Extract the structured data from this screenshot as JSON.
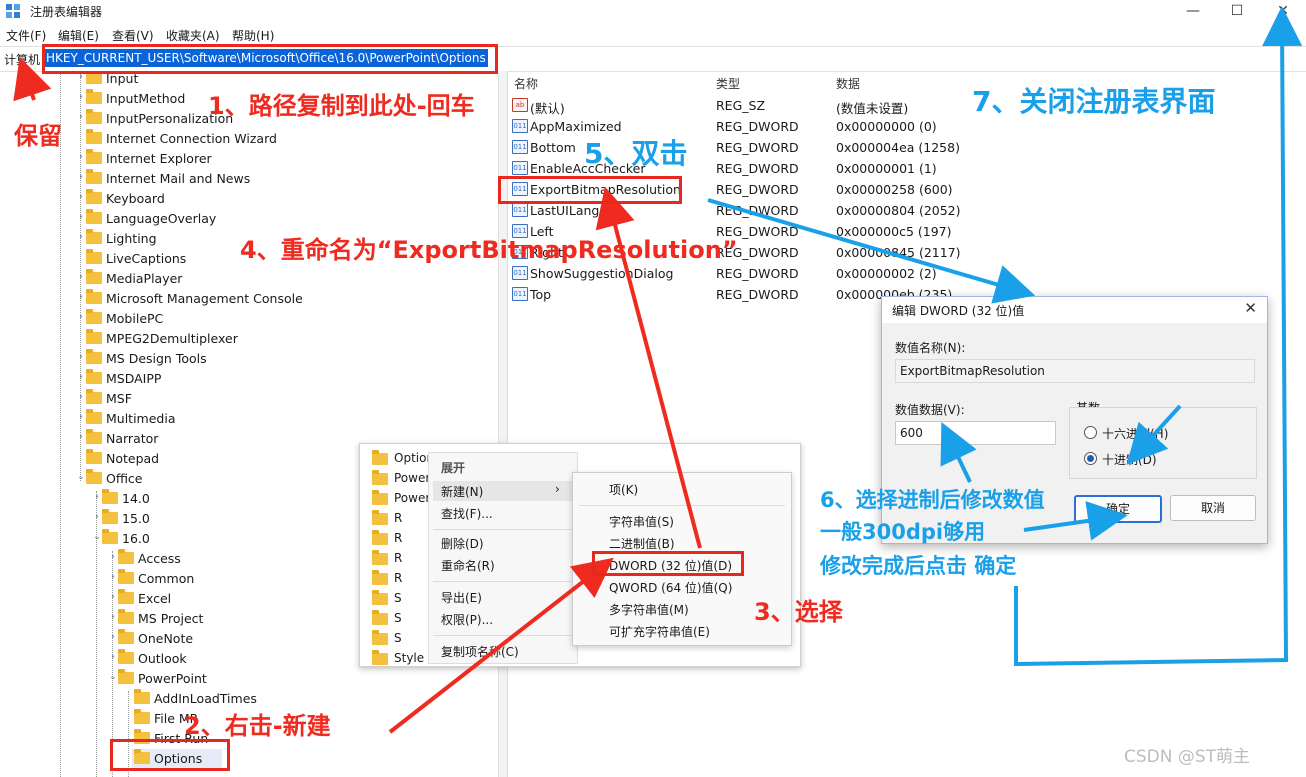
{
  "window": {
    "title": "注册表编辑器",
    "minimize": "—",
    "maximize": "☐",
    "close": "✕"
  },
  "menu": [
    "文件(F)",
    "编辑(E)",
    "查看(V)",
    "收藏夹(A)",
    "帮助(H)"
  ],
  "address": {
    "label": "计算机",
    "path": "HKEY_CURRENT_USER\\Software\\Microsoft\\Office\\16.0\\PowerPoint\\Options"
  },
  "tree": [
    {
      "label": "Input",
      "level": 0,
      "expander": "›"
    },
    {
      "label": "InputMethod",
      "level": 0,
      "expander": "›"
    },
    {
      "label": "InputPersonalization",
      "level": 0,
      "expander": "›"
    },
    {
      "label": "Internet Connection Wizard",
      "level": 0,
      "expander": ""
    },
    {
      "label": "Internet Explorer",
      "level": 0,
      "expander": "›"
    },
    {
      "label": "Internet Mail and News",
      "level": 0,
      "expander": "›"
    },
    {
      "label": "Keyboard",
      "level": 0,
      "expander": "›"
    },
    {
      "label": "LanguageOverlay",
      "level": 0,
      "expander": "›"
    },
    {
      "label": "Lighting",
      "level": 0,
      "expander": "›"
    },
    {
      "label": "LiveCaptions",
      "level": 0,
      "expander": ""
    },
    {
      "label": "MediaPlayer",
      "level": 0,
      "expander": "›"
    },
    {
      "label": "Microsoft Management Console",
      "level": 0,
      "expander": "›"
    },
    {
      "label": "MobilePC",
      "level": 0,
      "expander": "›"
    },
    {
      "label": "MPEG2Demultiplexer",
      "level": 0,
      "expander": ""
    },
    {
      "label": "MS Design Tools",
      "level": 0,
      "expander": "›"
    },
    {
      "label": "MSDAIPP",
      "level": 0,
      "expander": "›"
    },
    {
      "label": "MSF",
      "level": 0,
      "expander": "›"
    },
    {
      "label": "Multimedia",
      "level": 0,
      "expander": "›"
    },
    {
      "label": "Narrator",
      "level": 0,
      "expander": "›"
    },
    {
      "label": "Notepad",
      "level": 0,
      "expander": ""
    },
    {
      "label": "Office",
      "level": 0,
      "expander": "⌄"
    },
    {
      "label": "14.0",
      "level": 1,
      "expander": "›"
    },
    {
      "label": "15.0",
      "level": 1,
      "expander": "›"
    },
    {
      "label": "16.0",
      "level": 1,
      "expander": "⌄"
    },
    {
      "label": "Access",
      "level": 2,
      "expander": "›"
    },
    {
      "label": "Common",
      "level": 2,
      "expander": "›"
    },
    {
      "label": "Excel",
      "level": 2,
      "expander": "›"
    },
    {
      "label": "MS Project",
      "level": 2,
      "expander": "›"
    },
    {
      "label": "OneNote",
      "level": 2,
      "expander": "›"
    },
    {
      "label": "Outlook",
      "level": 2,
      "expander": "›"
    },
    {
      "label": "PowerPoint",
      "level": 2,
      "expander": "⌄"
    },
    {
      "label": "AddInLoadTimes",
      "level": 3,
      "expander": ""
    },
    {
      "label": "File MR",
      "level": 3,
      "expander": ""
    },
    {
      "label": "First Run",
      "level": 3,
      "expander": ""
    },
    {
      "label": "Options",
      "level": 3,
      "expander": ""
    }
  ],
  "values": {
    "headers": {
      "name": "名称",
      "type": "类型",
      "data": "数据"
    },
    "rows": [
      {
        "icon": "ab",
        "name": "(默认)",
        "type": "REG_SZ",
        "data": "(数值未设置)"
      },
      {
        "icon": "011",
        "name": "AppMaximized",
        "type": "REG_DWORD",
        "data": "0x00000000 (0)"
      },
      {
        "icon": "011",
        "name": "Bottom",
        "type": "REG_DWORD",
        "data": "0x000004ea (1258)"
      },
      {
        "icon": "011",
        "name": "EnableAccChecker",
        "type": "REG_DWORD",
        "data": "0x00000001 (1)"
      },
      {
        "icon": "011",
        "name": "ExportBitmapResolution",
        "type": "REG_DWORD",
        "data": "0x00000258 (600)"
      },
      {
        "icon": "011",
        "name": "LastUILang",
        "type": "REG_DWORD",
        "data": "0x00000804 (2052)"
      },
      {
        "icon": "011",
        "name": "Left",
        "type": "REG_DWORD",
        "data": "0x000000c5 (197)"
      },
      {
        "icon": "011",
        "name": "Right",
        "type": "REG_DWORD",
        "data": "0x00000845 (2117)"
      },
      {
        "icon": "011",
        "name": "ShowSuggestionDialog",
        "type": "REG_DWORD",
        "data": "0x00000002 (2)"
      },
      {
        "icon": "011",
        "name": "Top",
        "type": "REG_DWORD",
        "data": "0x000000eb (235)"
      }
    ]
  },
  "context": {
    "mini_tree": [
      "Options",
      "PowerPoint",
      "PowerPoint",
      "R",
      "R",
      "R",
      "R",
      "S",
      "S",
      "S",
      "Style Checker"
    ],
    "menu1": {
      "expand": "展开",
      "new": "新建(N)",
      "find": "查找(F)...",
      "delete": "删除(D)",
      "rename": "重命名(R)",
      "export": "导出(E)",
      "permissions": "权限(P)...",
      "copy_key": "复制项名称(C)",
      "submenu_arrow": "›"
    },
    "menu2": {
      "key": "项(K)",
      "string": "字符串值(S)",
      "binary": "二进制值(B)",
      "dword": "DWORD (32 位)值(D)",
      "qword": "QWORD (64 位)值(Q)",
      "multi": "多字符串值(M)",
      "expand_string": "可扩充字符串值(E)"
    }
  },
  "dialog": {
    "title": "编辑 DWORD (32 位)值",
    "close": "✕",
    "name_label": "数值名称(N):",
    "name_value": "ExportBitmapResolution",
    "data_label": "数值数据(V):",
    "data_value": "600",
    "base_label": "基数",
    "hex": "十六进制(H)",
    "dec": "十进制(D)",
    "ok": "确定",
    "cancel": "取消"
  },
  "annotations": {
    "step1": "1、路径复制到此处-回车",
    "keep": "保留",
    "step2": "2、右击-新建",
    "step3": "3、选择",
    "step4": "4、重命名为“ExportBitmapResolution”",
    "step5": "5、双击",
    "step6a": "6、选择进制后修改数值",
    "step6b": "一般300dpi够用",
    "step6c": "修改完成后点击 确定",
    "step7": "7、关闭注册表界面",
    "red": "#ef2a1f",
    "blue": "#1aa0e8"
  },
  "watermark": "CSDN @ST萌主"
}
